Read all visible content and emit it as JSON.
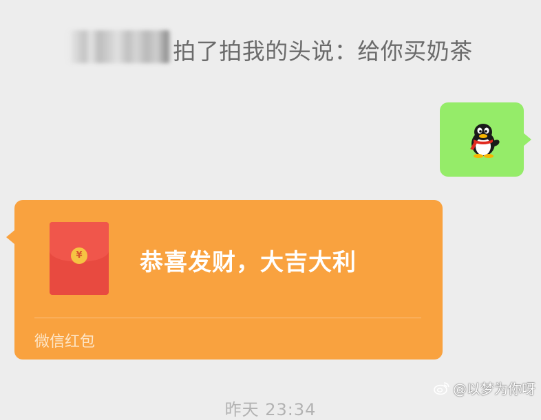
{
  "pat_notice": {
    "text": "拍了拍我的头说：给你买奶茶"
  },
  "sticker": {
    "icon": "qq-penguin-icon"
  },
  "red_packet": {
    "greeting": "恭喜发财，大吉大利",
    "coin_symbol": "¥",
    "footer": "微信红包",
    "color": "#f9a23f"
  },
  "timestamp": {
    "text": "昨天 23:34"
  },
  "watermark": {
    "text": "@以梦为你呀"
  },
  "colors": {
    "background": "#ededed",
    "outgoing_bubble": "#95ec69",
    "envelope": "#e84a40",
    "coin": "#f6c343"
  }
}
